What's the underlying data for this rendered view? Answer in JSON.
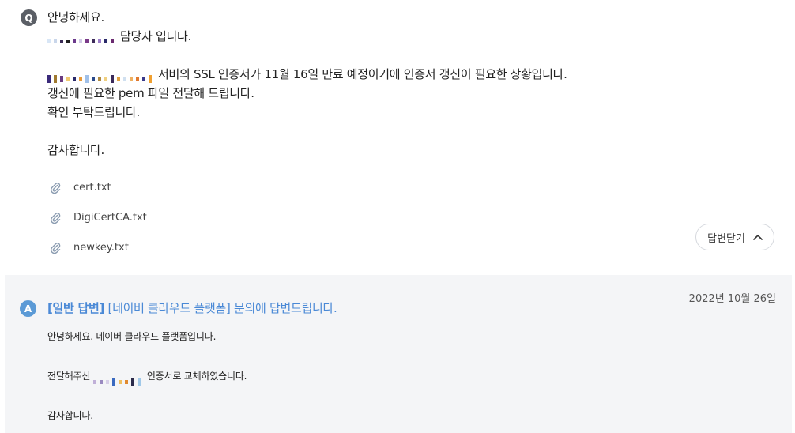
{
  "question": {
    "icon_letter": "Q",
    "greeting": "안녕하세요.",
    "signature_suffix": "담당자 입니다.",
    "line_ssl": "서버의 SSL 인증서가 11월 16일 만료 예정이기에 인증서 갱신이 필요한 상황입니다.",
    "line_pem": "갱신에 필요한 pem 파일 전달해 드립니다.",
    "line_confirm": "확인 부탁드립니다.",
    "line_thanks": "감사합니다.",
    "attachments": [
      {
        "name": "cert.txt",
        "icon": "paperclip-icon"
      },
      {
        "name": "DigiCertCA.txt",
        "icon": "paperclip-icon"
      },
      {
        "name": "newkey.txt",
        "icon": "paperclip-icon"
      }
    ],
    "close_answer_label": "답변닫기"
  },
  "answer": {
    "icon_letter": "A",
    "tag": "[일반 답변]",
    "title": "[네이버 클라우드 플랫폼] 문의에 답변드립니다.",
    "date": "2022년 10월 26일",
    "line_greeting": "안녕하세요. 네이버 클라우드 플랫폼입니다.",
    "line_replaced_prefix": "전달해주신",
    "line_replaced_suffix": "인증서로 교체하였습니다.",
    "line_thanks": "감사합니다."
  },
  "colors": {
    "question_icon": "#5b5f66",
    "answer_icon": "#5b9ad6",
    "answer_title": "#4a89d6",
    "answer_background": "#f4f5f7"
  }
}
